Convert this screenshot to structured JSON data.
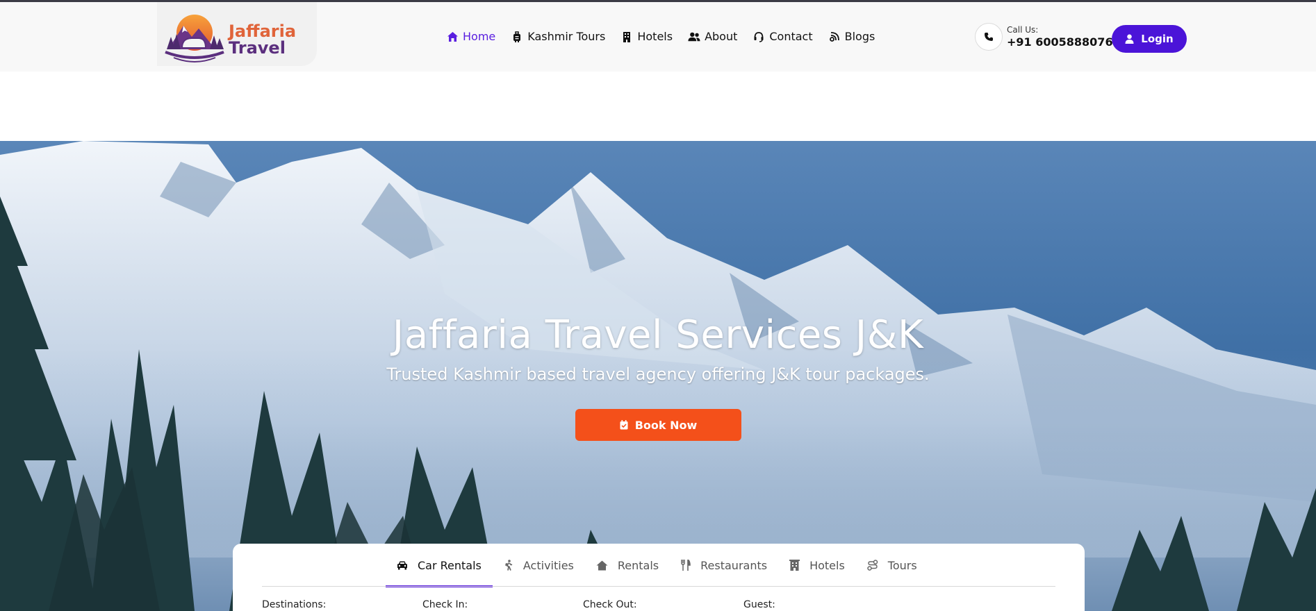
{
  "logo": {
    "line1": "Jaffaria",
    "line2": "Travel"
  },
  "nav": [
    {
      "label": "Home",
      "icon": "home-icon",
      "active": true
    },
    {
      "label": "Kashmir Tours",
      "icon": "luggage-icon",
      "active": false
    },
    {
      "label": "Hotels",
      "icon": "building-icon",
      "active": false
    },
    {
      "label": "About",
      "icon": "users-icon",
      "active": false
    },
    {
      "label": "Contact",
      "icon": "headset-icon",
      "active": false
    },
    {
      "label": "Blogs",
      "icon": "blog-icon",
      "active": false
    }
  ],
  "call": {
    "label": "Call Us:",
    "number": "+91 6005888076",
    "icon": "phone-icon"
  },
  "login": {
    "label": "Login",
    "icon": "user-icon"
  },
  "hero": {
    "title": "Jaffaria Travel Services J&K",
    "subtitle": "Trusted Kashmir based travel agency offering J&K tour packages.",
    "book_label": "Book Now",
    "book_icon": "calendar-check-icon"
  },
  "search": {
    "tabs": [
      {
        "label": "Car Rentals",
        "icon": "car-icon",
        "active": true
      },
      {
        "label": "Activities",
        "icon": "hiking-icon",
        "active": false
      },
      {
        "label": "Rentals",
        "icon": "house-icon",
        "active": false
      },
      {
        "label": "Restaurants",
        "icon": "utensils-icon",
        "active": false
      },
      {
        "label": "Hotels",
        "icon": "hotel-icon",
        "active": false
      },
      {
        "label": "Tours",
        "icon": "route-icon",
        "active": false
      }
    ],
    "fields": [
      "Destinations:",
      "Check In:",
      "Check Out:",
      "Guest:"
    ]
  },
  "colors": {
    "accent": "#5a1fe0",
    "login_bg": "#4b14d8",
    "book_bg": "#f4501a",
    "logo_orange": "#e0643a",
    "logo_purple": "#5b2f7e"
  }
}
